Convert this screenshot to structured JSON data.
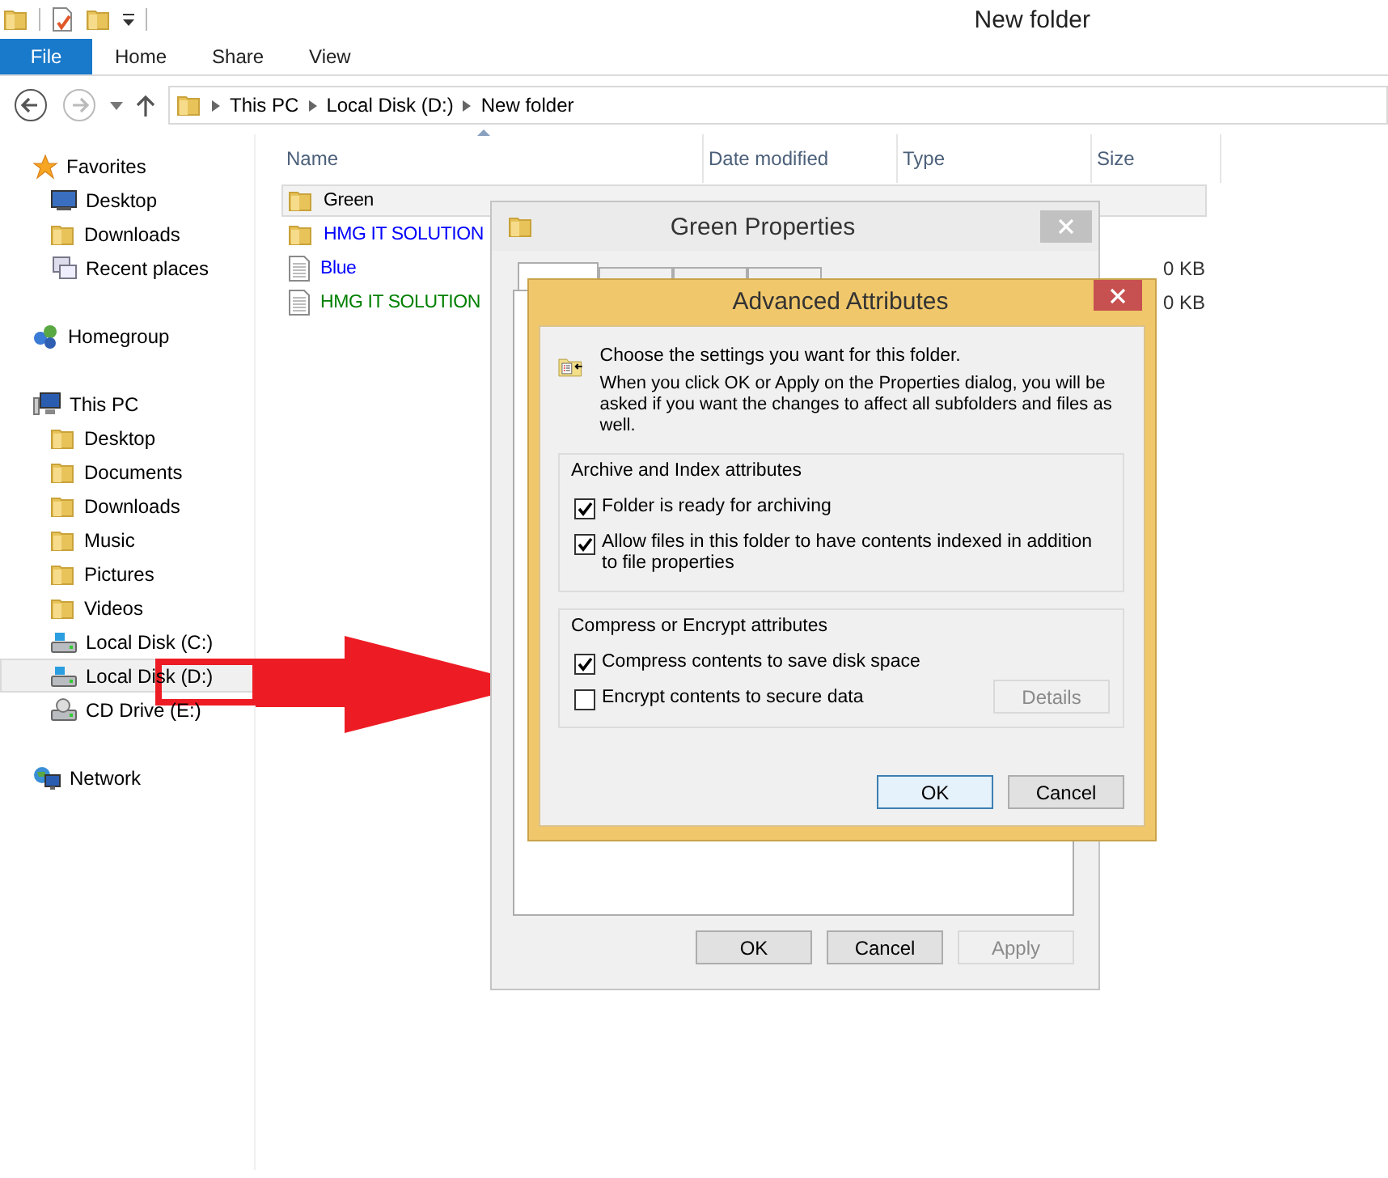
{
  "window": {
    "title": "New folder"
  },
  "ribbon_tabs": [
    {
      "label": "File",
      "kind": "file"
    },
    {
      "label": "Home",
      "kind": "tab"
    },
    {
      "label": "Share",
      "kind": "tab"
    },
    {
      "label": "View",
      "kind": "tab"
    }
  ],
  "address_bar": {
    "path": [
      "This PC",
      "Local Disk (D:)",
      "New folder"
    ]
  },
  "navigation_pane": [
    {
      "label": "Favorites",
      "selected": false,
      "children": [
        {
          "label": "Desktop",
          "selected": false
        },
        {
          "label": "Downloads",
          "selected": false
        },
        {
          "label": "Recent places",
          "selected": false
        }
      ]
    },
    {
      "label": "Homegroup",
      "selected": false
    },
    {
      "label": "This PC",
      "selected": false,
      "children": [
        {
          "label": "Desktop",
          "selected": false
        },
        {
          "label": "Documents",
          "selected": false
        },
        {
          "label": "Downloads",
          "selected": false
        },
        {
          "label": "Music",
          "selected": false
        },
        {
          "label": "Pictures",
          "selected": false
        },
        {
          "label": "Videos",
          "selected": false
        },
        {
          "label": "Local Disk (C:)",
          "selected": false
        },
        {
          "label": "Local Disk (D:)",
          "selected": true
        },
        {
          "label": "CD Drive (E:)",
          "selected": false
        }
      ]
    },
    {
      "label": "Network",
      "selected": false
    }
  ],
  "file_list": {
    "columns": [
      "Name",
      "Date modified",
      "Type",
      "Size"
    ],
    "rows": [
      {
        "name": "Green",
        "kind": "folder",
        "color": "#000000",
        "selected": true
      },
      {
        "name": "HMG IT SOLUTION",
        "kind": "folder",
        "color": "#0000ff",
        "selected": false
      },
      {
        "name": "Blue",
        "kind": "file",
        "color": "#0000ff",
        "selected": false,
        "size": "0 KB"
      },
      {
        "name": "HMG IT SOLUTION",
        "kind": "file",
        "color": "#008000",
        "selected": false,
        "size": "0 KB"
      }
    ]
  },
  "properties_dialog": {
    "title": "Green Properties",
    "tabs": [
      {
        "selected": true
      },
      {
        "selected": false
      },
      {
        "selected": false
      },
      {
        "selected": false
      }
    ],
    "buttons": [
      {
        "label": "OK",
        "disabled": false
      },
      {
        "label": "Cancel",
        "disabled": false
      },
      {
        "label": "Apply",
        "disabled": true
      }
    ]
  },
  "advanced_dialog": {
    "title": "Advanced Attributes",
    "intro": "Choose the settings you want for this folder.",
    "note": "When you click OK or Apply on the Properties dialog, you will be asked if you want the changes to affect all subfolders and files as well.",
    "groups": [
      {
        "title": "Archive and Index attributes",
        "options": [
          {
            "label": "Folder is ready for archiving",
            "checked": true
          },
          {
            "label": "Allow files in this folder to have contents indexed in addition to file properties",
            "checked": true
          }
        ]
      },
      {
        "title": "Compress or Encrypt attributes",
        "options": [
          {
            "label": "Compress contents to save disk space",
            "checked": true
          },
          {
            "label": "Encrypt contents to secure data",
            "checked": false
          }
        ],
        "button": {
          "label": "Details",
          "disabled": true
        }
      }
    ],
    "buttons": [
      {
        "label": "OK",
        "default": true
      },
      {
        "label": "Cancel",
        "default": false
      }
    ]
  }
}
